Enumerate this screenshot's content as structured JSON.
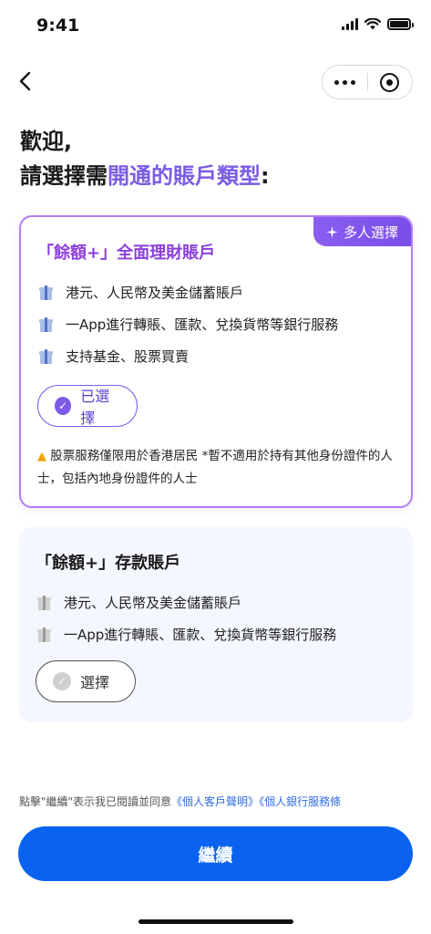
{
  "status_bar": {
    "time": "9:41"
  },
  "header": {
    "title_line1": "歡迎,",
    "title_line2_prefix": "請選擇需",
    "title_line2_accent": "開通的賬戶類型",
    "title_line2_suffix": ":"
  },
  "cards": [
    {
      "badge": "多人選擇",
      "title": "「餘額+」全面理財賬戶",
      "features": [
        "港元、人民幣及美金儲蓄賬戶",
        "一App進行轉賬、匯款、兌換貨幣等銀行服務",
        "支持基金、股票買賣"
      ],
      "button_label": "已選擇",
      "selected": true,
      "notice": "股票服務僅限用於香港居民 *暫不適用於持有其他身份證件的人士，包括內地身份證件的人士"
    },
    {
      "title": "「餘額+」存款賬戶",
      "features": [
        "港元、人民幣及美金儲蓄賬戶",
        "一App進行轉賬、匯款、兌換貨幣等銀行服務"
      ],
      "button_label": "選擇",
      "selected": false
    }
  ],
  "footer": {
    "agreement_text": "點擊\"繼續\"表示我已閱讀並同意",
    "link1": "《個人客戶聲明》",
    "link2": "《個人銀行服務條",
    "continue_label": "繼續"
  },
  "icons": {
    "back": "chevron-left-icon",
    "more": "more-dots-icon",
    "close": "miniprogram-close-icon",
    "sparkle": "sparkle-icon",
    "feature": "gift-icon",
    "check": "check-circle-icon",
    "warning": "warning-icon"
  },
  "colors": {
    "accent": "#7b5be6",
    "primary": "#0a63f0",
    "card_border": "#b27cf2",
    "link": "#2f6de0"
  }
}
